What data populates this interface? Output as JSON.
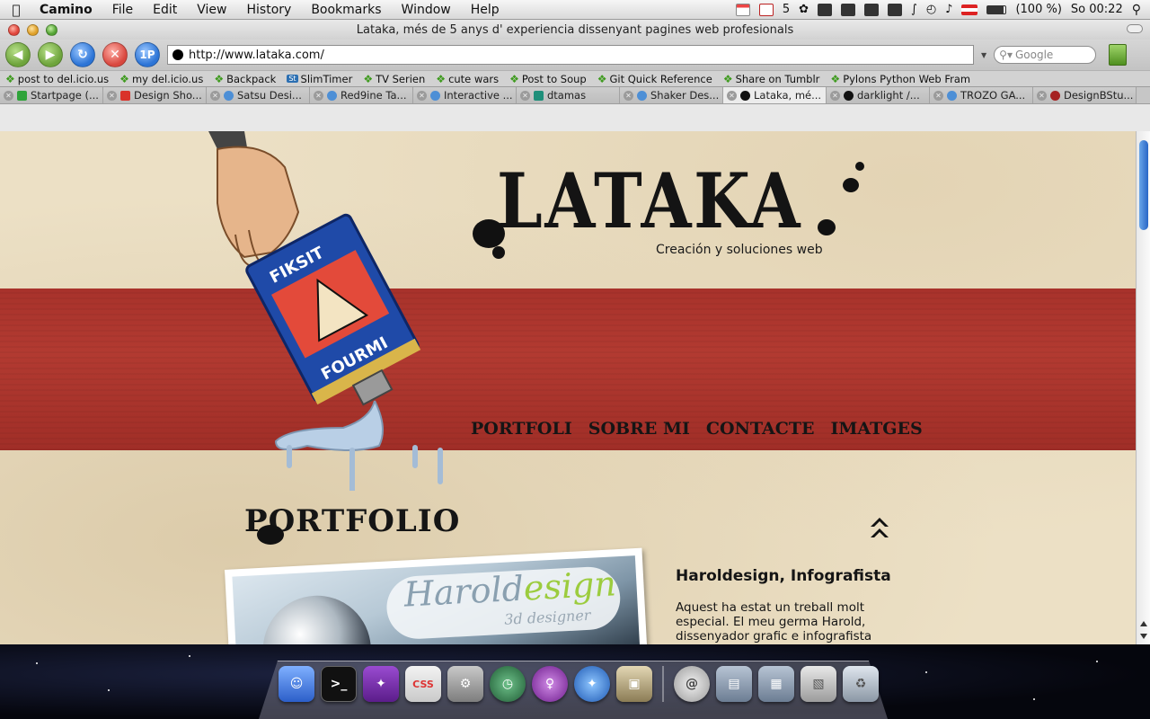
{
  "menubar": {
    "app": "Camino",
    "menus": [
      "File",
      "Edit",
      "View",
      "History",
      "Bookmarks",
      "Window",
      "Help"
    ],
    "mail_count": "5",
    "battery": "(100 %)",
    "clock": "So 00:22"
  },
  "window": {
    "title": "Lataka, més de 5 anys d' experiencia dissenyant pagines web profesionals"
  },
  "toolbar": {
    "onepass_label": "1P",
    "url": "http://www.lataka.com/",
    "search_placeholder": "Google"
  },
  "bookmarks": [
    "post to del.icio.us",
    "my del.icio.us",
    "Backpack",
    "SlimTimer",
    "TV Serien",
    "cute wars",
    "Post to Soup",
    "Git Quick Reference",
    "Share on Tumblr",
    "Pylons Python Web Fram"
  ],
  "tabs": [
    "Startpage (...",
    "Design Sho...",
    "Satsu Desi...",
    "Red9ine Ta...",
    "Interactive ...",
    "dtamas",
    "Shaker Des...",
    "Lataka, mé...",
    "darklight /...",
    "TROZO GA...",
    "DesignBStu..."
  ],
  "page": {
    "logo": "LATAKA",
    "tagline": "Creación y soluciones web",
    "nav": [
      "PORTFOLI",
      "SOBRE MI",
      "CONTACTE",
      "IMATGES"
    ],
    "section_title": "PORTFOLIO",
    "project": {
      "title": "Haroldesign, Infografista",
      "description": "Aquest ha estat un treball molt especial. El meu germa Harold, dissenyador grafic e infografista de naixement es va decidir a crear el",
      "thumb_brand_a": "Harold",
      "thumb_brand_b": "esign",
      "thumb_sub": "3d designer"
    },
    "colors": {
      "band_red": "#a8322b",
      "paper": "#ece0c5",
      "ink": "#151515"
    }
  },
  "dock": {
    "css_label": "CSS"
  }
}
